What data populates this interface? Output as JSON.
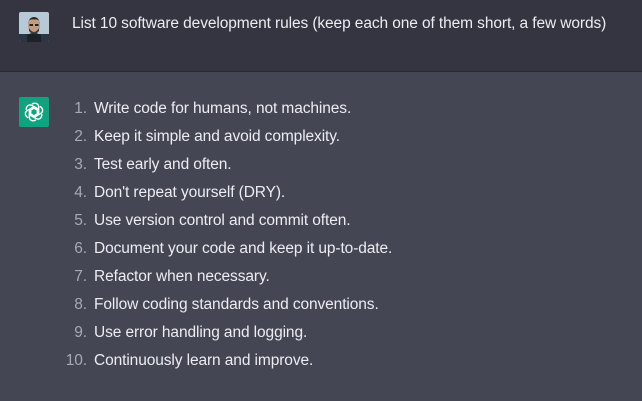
{
  "user_message": {
    "avatar_icon": "user-avatar-icon",
    "text": "List 10 software development rules (keep each one of them short, a few words)"
  },
  "assistant_message": {
    "avatar_icon": "openai-logo-icon",
    "avatar_color": "#10a37f",
    "items": [
      {
        "num": "1.",
        "text": "Write code for humans, not machines."
      },
      {
        "num": "2.",
        "text": "Keep it simple and avoid complexity."
      },
      {
        "num": "3.",
        "text": "Test early and often."
      },
      {
        "num": "4.",
        "text": "Don't repeat yourself (DRY)."
      },
      {
        "num": "5.",
        "text": "Use version control and commit often."
      },
      {
        "num": "6.",
        "text": "Document your code and keep it up-to-date."
      },
      {
        "num": "7.",
        "text": "Refactor when necessary."
      },
      {
        "num": "8.",
        "text": "Follow coding standards and conventions."
      },
      {
        "num": "9.",
        "text": "Use error handling and logging."
      },
      {
        "num": "10.",
        "text": "Continuously learn and improve."
      }
    ]
  },
  "colors": {
    "user_row_bg": "#343541",
    "assistant_row_bg": "#444654",
    "text": "#ececf1",
    "number_text": "#a9a9b3"
  }
}
